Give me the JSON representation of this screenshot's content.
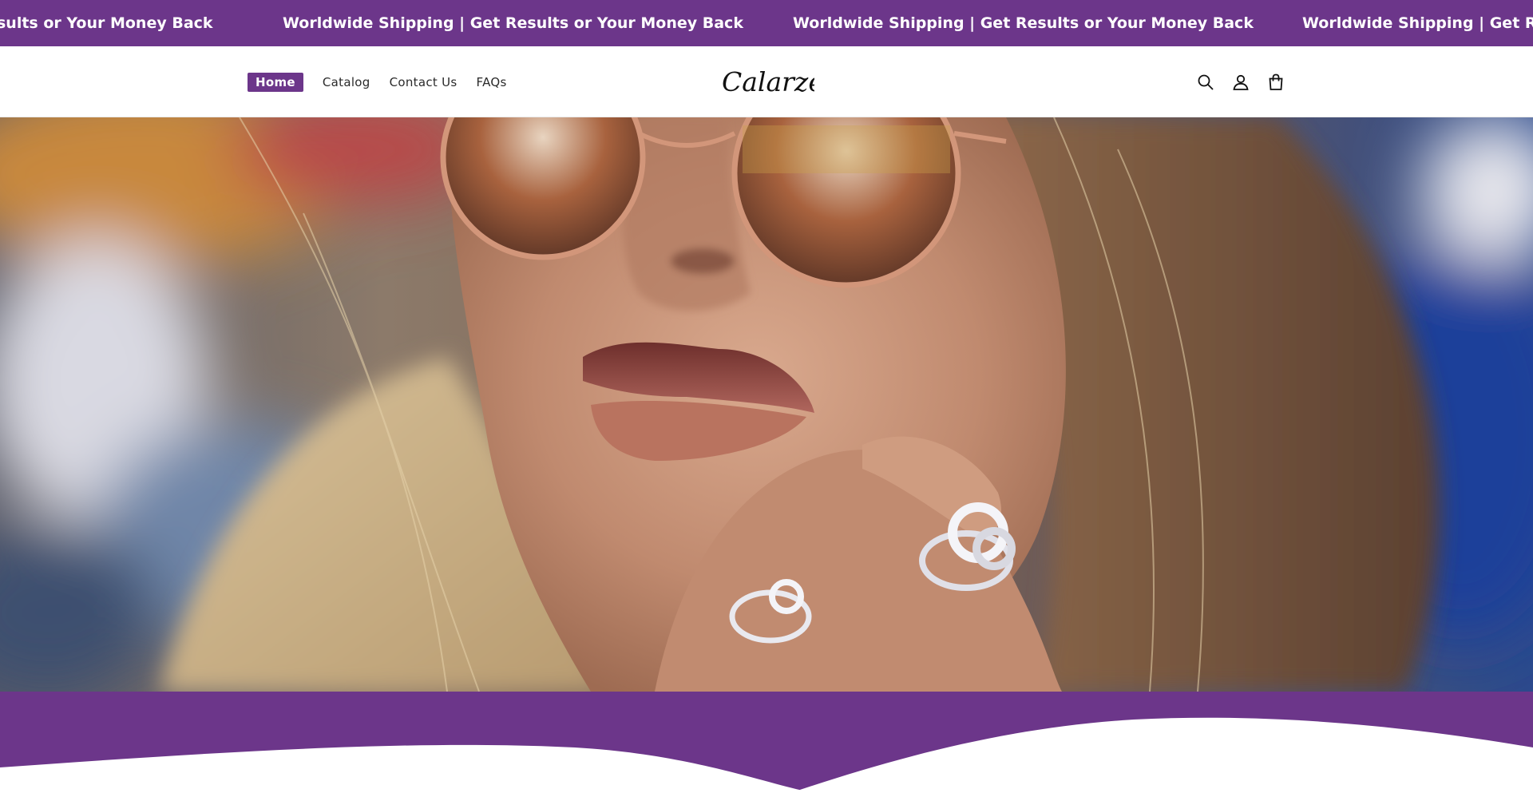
{
  "announcement": {
    "text": "Worldwide Shipping | Get Results or Your Money Back",
    "partial_start": "sults or Your Money Back",
    "partial_end": "Worldwide Shipping | Get Res"
  },
  "nav": {
    "items": [
      {
        "label": "Home",
        "active": true
      },
      {
        "label": "Catalog",
        "active": false
      },
      {
        "label": "Contact Us",
        "active": false
      },
      {
        "label": "FAQs",
        "active": false
      }
    ]
  },
  "brand": {
    "name": "Calarze"
  },
  "header_icons": [
    "search-icon",
    "account-icon",
    "cart-icon"
  ],
  "colors": {
    "accent": "#6c368a",
    "background": "#ffffff",
    "text": "#2a2a2a"
  }
}
